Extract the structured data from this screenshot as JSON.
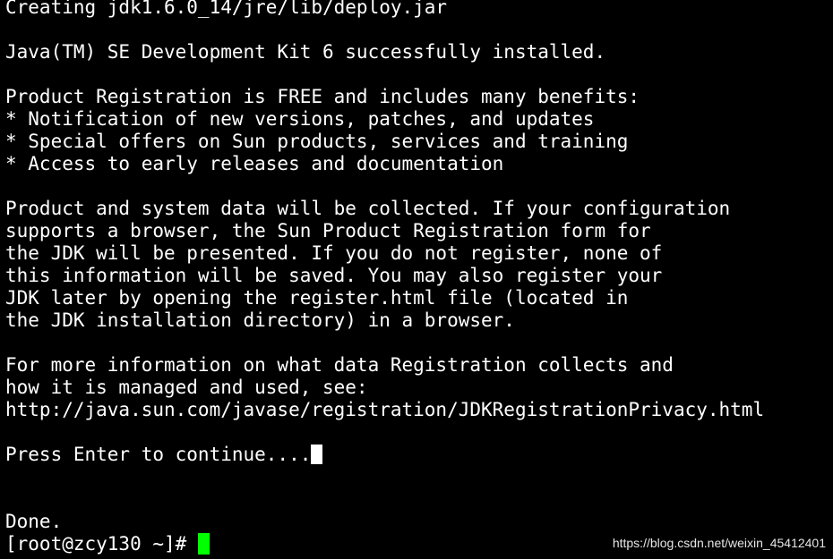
{
  "terminal": {
    "lines": [
      "Creating jdk1.6.0_14/jre/lib/deploy.jar",
      "",
      "Java(TM) SE Development Kit 6 successfully installed.",
      "",
      "Product Registration is FREE and includes many benefits:",
      "* Notification of new versions, patches, and updates",
      "* Special offers on Sun products, services and training",
      "* Access to early releases and documentation",
      "",
      "Product and system data will be collected. If your configuration",
      "supports a browser, the Sun Product Registration form for",
      "the JDK will be presented. If you do not register, none of",
      "this information will be saved. You may also register your",
      "JDK later by opening the register.html file (located in",
      "the JDK installation directory) in a browser.",
      "",
      "For more information on what data Registration collects and",
      "how it is managed and used, see:",
      "http://java.sun.com/javase/registration/JDKRegistrationPrivacy.html",
      "",
      "Press Enter to continue....",
      "",
      "",
      "Done.",
      "[root@zcy130 ~]#"
    ],
    "prompt_cursor_color": "#00ff00",
    "text_color": "#ffffff",
    "background_color": "#000000"
  },
  "watermark": "https://blog.csdn.net/weixin_45412401"
}
